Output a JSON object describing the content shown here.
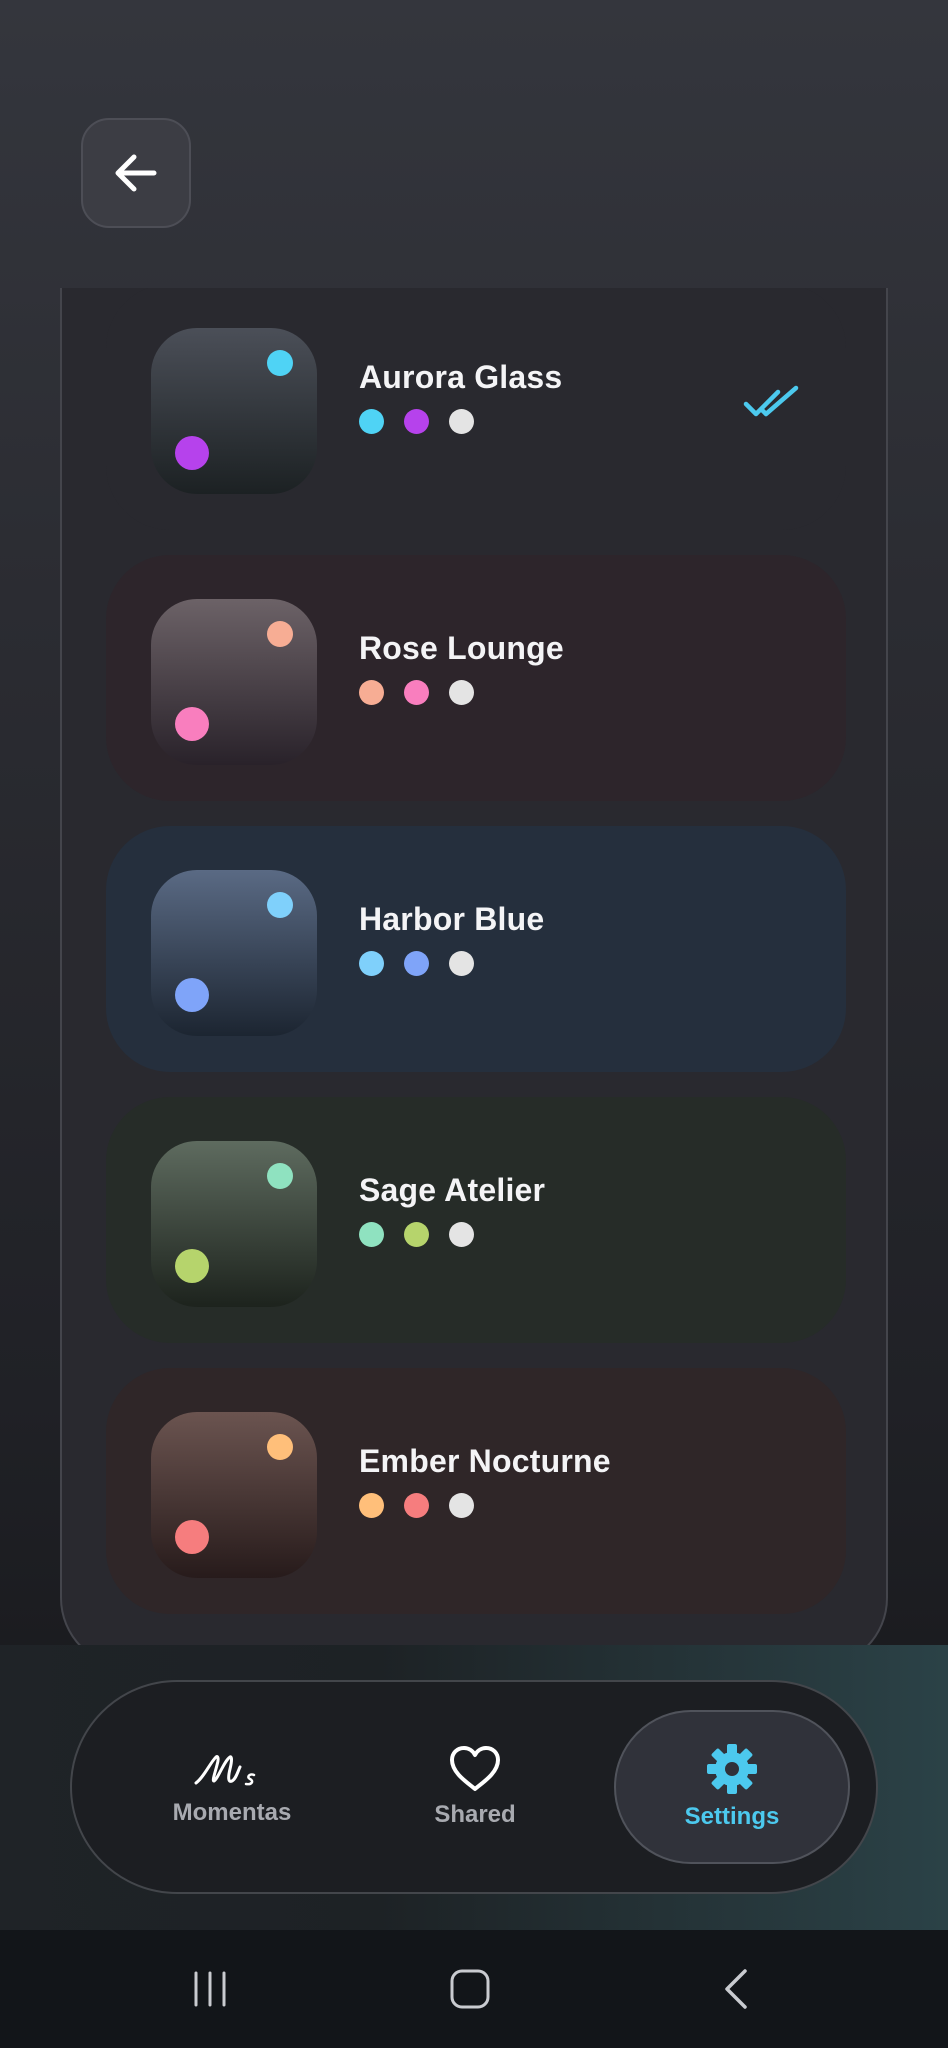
{
  "header": {
    "back_icon": "arrow-left-icon"
  },
  "themes": [
    {
      "name": "Aurora Glass",
      "selected": true,
      "bg": "#29292f",
      "swatch_top": "#4b4f58",
      "swatch_bottom": "#1c2123",
      "accent": "#4fd3f5",
      "secondary": "#b642ec",
      "neutral": "#e4e4e4"
    },
    {
      "name": "Rose Lounge",
      "selected": false,
      "bg": "#2d252b",
      "swatch_top": "#6c6267",
      "swatch_bottom": "#29222a",
      "accent": "#f7ad94",
      "secondary": "#f97ebe",
      "neutral": "#e4e4e4"
    },
    {
      "name": "Harbor Blue",
      "selected": false,
      "bg": "#252f3d",
      "swatch_top": "#5a6a84",
      "swatch_bottom": "#1c2531",
      "accent": "#7fd0fb",
      "secondary": "#7fa4f9",
      "neutral": "#e4e4e4"
    },
    {
      "name": "Sage Atelier",
      "selected": false,
      "bg": "#262c28",
      "swatch_top": "#5e6b5f",
      "swatch_bottom": "#1d231d",
      "accent": "#8fe2c0",
      "secondary": "#b6d46c",
      "neutral": "#e4e4e4"
    },
    {
      "name": "Ember Nocturne",
      "selected": false,
      "bg": "#2f2628",
      "swatch_top": "#6b5450",
      "swatch_bottom": "#271b1b",
      "accent": "#ffbf7a",
      "secondary": "#f67d7e",
      "neutral": "#e4e4e4"
    }
  ],
  "selected_icon": "double-check-icon",
  "tabbar": {
    "tabs": [
      {
        "label": "Momentas",
        "icon": "momentas-logo-icon",
        "active": false
      },
      {
        "label": "Shared",
        "icon": "heart-icon",
        "active": false
      },
      {
        "label": "Settings",
        "icon": "gear-icon",
        "active": true
      }
    ]
  },
  "colors": {
    "accent": "#4cc9ee"
  },
  "system_nav": [
    "recents-icon",
    "home-icon",
    "back-chevron-icon"
  ]
}
